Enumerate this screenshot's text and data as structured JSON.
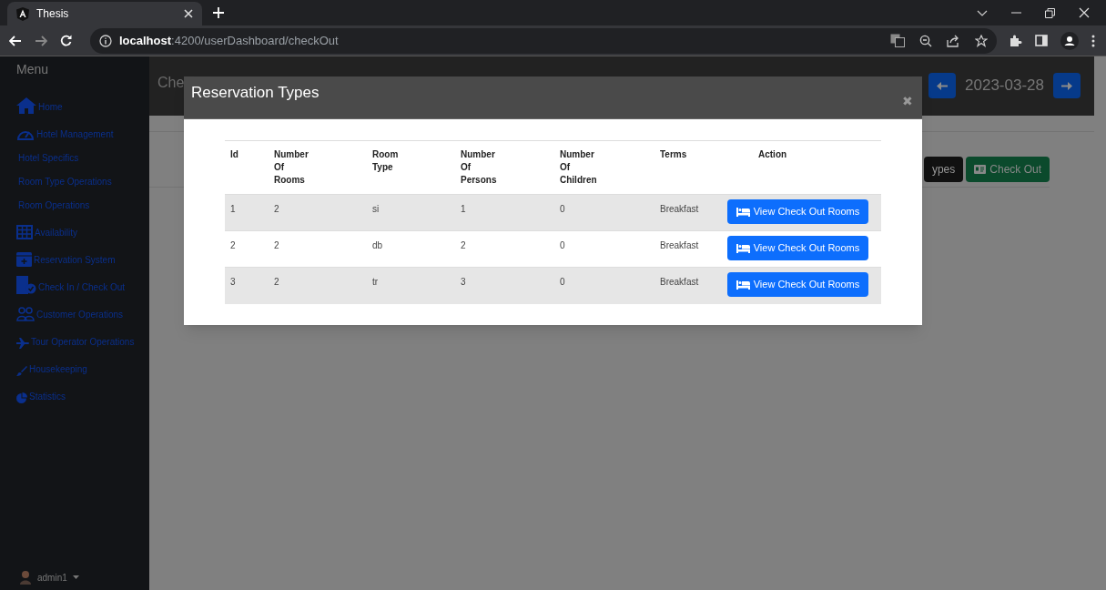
{
  "browser": {
    "tab_title": "Thesis",
    "url_host": "localhost",
    "url_path": ":4200/userDashboard/checkOut"
  },
  "sidebar": {
    "title": "Menu",
    "items": [
      {
        "label": "Home"
      },
      {
        "label": "Hotel Management",
        "children": [
          {
            "label": "Hotel Specifics"
          },
          {
            "label": "Room Type Operations"
          },
          {
            "label": "Room Operations"
          }
        ]
      },
      {
        "label": "Availability"
      },
      {
        "label": "Reservation System"
      },
      {
        "label": "Check In / Check Out"
      },
      {
        "label": "Customer Operations"
      },
      {
        "label": "Tour Operator Operations"
      },
      {
        "label": "Housekeeping"
      },
      {
        "label": "Statistics"
      }
    ],
    "user": "admin1"
  },
  "header": {
    "title": "Che",
    "date": "2023-03-28"
  },
  "toolbar": [
    {
      "label": "ypes",
      "kind": "dark"
    },
    {
      "label": "Check Out",
      "kind": "success"
    }
  ],
  "modal": {
    "title": "Reservation Types",
    "close": "✖",
    "table": {
      "columns": [
        "Id",
        "Number Of Rooms",
        "Room Type",
        "Number Of Persons",
        "Number Of Children",
        "Terms",
        "Action"
      ],
      "rows": [
        {
          "cells": [
            "1",
            "2",
            "si",
            "1",
            "0",
            "Breakfast"
          ],
          "action": "View Check Out Rooms"
        },
        {
          "cells": [
            "2",
            "2",
            "db",
            "2",
            "0",
            "Breakfast"
          ],
          "action": "View Check Out Rooms"
        },
        {
          "cells": [
            "3",
            "2",
            "tr",
            "3",
            "0",
            "Breakfast"
          ],
          "action": "View Check Out Rooms"
        }
      ]
    }
  }
}
